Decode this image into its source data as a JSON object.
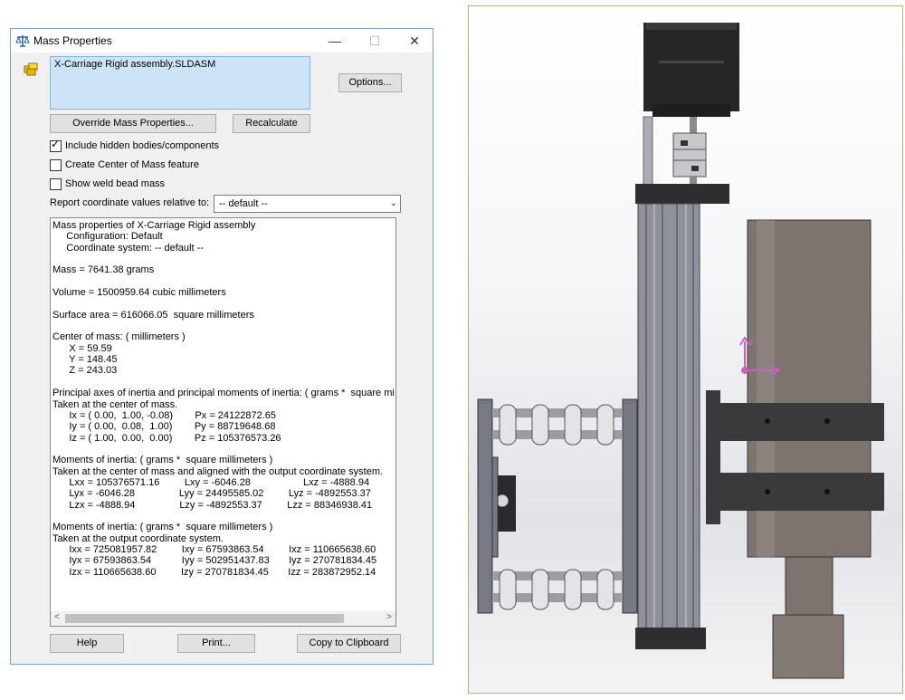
{
  "window": {
    "title": "Mass Properties",
    "min_glyph": "—",
    "max_glyph": "☐",
    "close_glyph": "✕"
  },
  "selection": {
    "item": "X-Carriage Rigid assembly.SLDASM"
  },
  "buttons": {
    "options": "Options...",
    "override": "Override Mass Properties...",
    "recalculate": "Recalculate",
    "help": "Help",
    "print": "Print...",
    "copy": "Copy to Clipboard"
  },
  "checkboxes": [
    {
      "label": "Include hidden bodies/components",
      "checked": true,
      "mark": "✓"
    },
    {
      "label": "Create Center of Mass feature",
      "checked": false,
      "mark": ""
    },
    {
      "label": "Show weld bead mass",
      "checked": false,
      "mark": ""
    }
  ],
  "report": {
    "label": "Report coordinate values relative to:",
    "value": "-- default --"
  },
  "results_lines": [
    "Mass properties of X-Carriage Rigid assembly",
    "     Configuration: Default",
    "     Coordinate system: -- default --",
    "",
    "Mass = 7641.38 grams",
    "",
    "Volume = 1500959.64 cubic millimeters",
    "",
    "Surface area = 616066.05  square millimeters",
    "",
    "Center of mass: ( millimeters )",
    "      X = 59.59",
    "      Y = 148.45",
    "      Z = 243.03",
    "",
    "Principal axes of inertia and principal moments of inertia: ( grams *  square millimeters )",
    "Taken at the center of mass.",
    "      Ix = ( 0.00,  1.00, -0.08)        Px = 24122872.65",
    "      Iy = ( 0.00,  0.08,  1.00)        Py = 88719648.68",
    "      Iz = ( 1.00,  0.00,  0.00)        Pz = 105376573.26",
    "",
    "Moments of inertia: ( grams *  square millimeters )",
    "Taken at the center of mass and aligned with the output coordinate system.",
    "      Lxx = 105376571.16         Lxy = -6046.28                   Lxz = -4888.94",
    "      Lyx = -6046.28                Lyy = 24495585.02         Lyz = -4892553.37",
    "      Lzx = -4888.94                Lzy = -4892553.37         Lzz = 88346938.41",
    "",
    "Moments of inertia: ( grams *  square millimeters )",
    "Taken at the output coordinate system.",
    "      Ixx = 725081957.82         Ixy = 67593863.54         Ixz = 110665638.60",
    "      Iyx = 67593863.54           Iyy = 502951437.83       Iyz = 270781834.45",
    "      Izx = 110665638.60         Izy = 270781834.45       Izz = 283872952.14"
  ],
  "scroll": {
    "left": "<",
    "right": ">"
  },
  "axis_labels": {
    "y": "y",
    "x": "x"
  },
  "colors": {
    "motor": "#2b2b2b",
    "cylinder": "#7a726c",
    "rail": "#8c8e98",
    "bracket": "#3a3a3c",
    "triad": "#d060c0"
  }
}
